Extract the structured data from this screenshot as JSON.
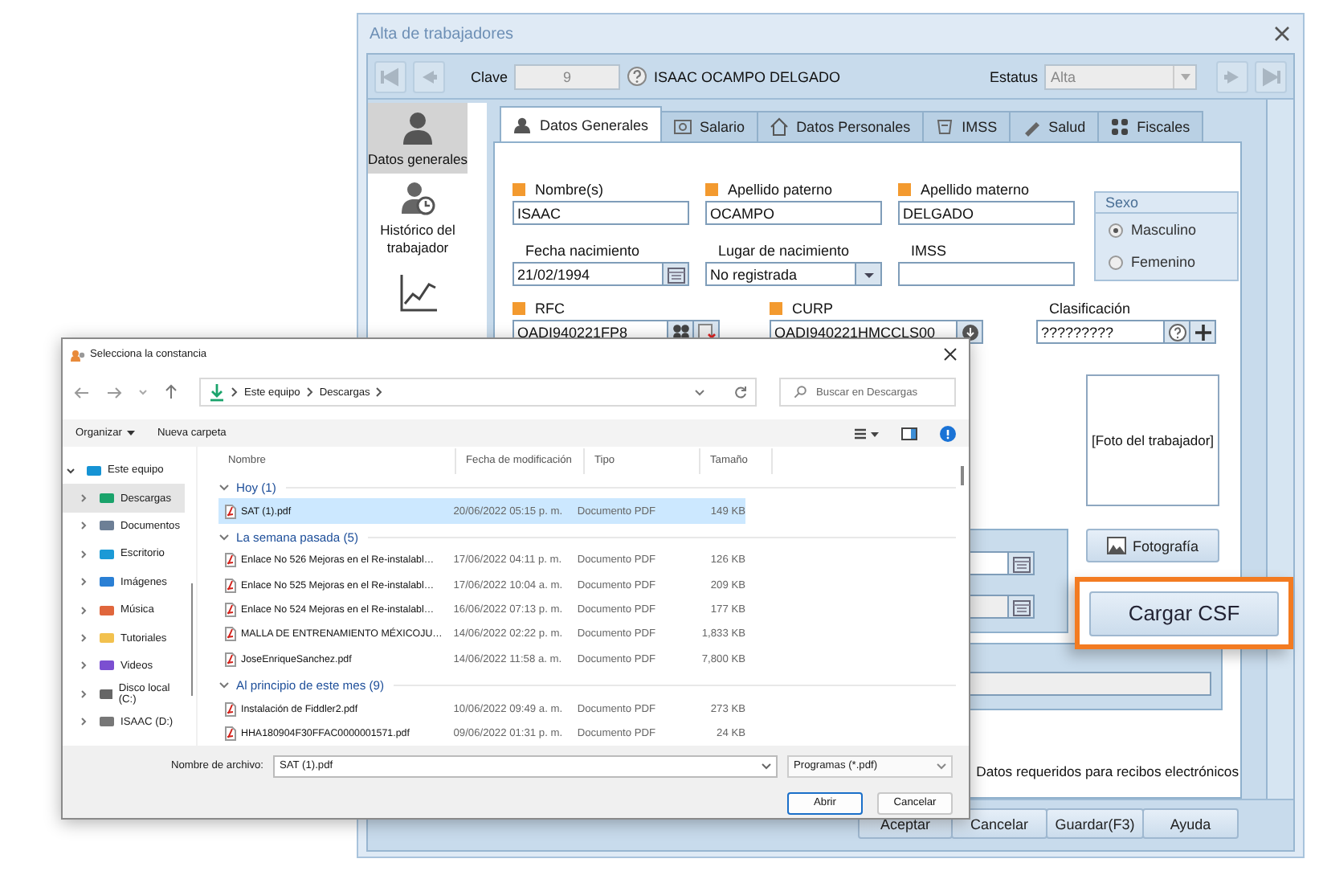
{
  "window": {
    "title": "Alta de trabajadores"
  },
  "record_bar": {
    "clave_label": "Clave",
    "clave": {
      "value": "9",
      "disabled": true
    },
    "employee_name": "ISAAC OCAMPO DELGADO",
    "estatus_label": "Estatus",
    "estatus": {
      "value": "Alta",
      "disabled": true
    }
  },
  "side_nav": [
    {
      "label": "Datos generales",
      "selected": true
    },
    {
      "label": "Histórico del trabajador",
      "selected": false
    }
  ],
  "tabs": [
    {
      "label": "Datos Generales",
      "selected": true
    },
    {
      "label": "Salario",
      "selected": false
    },
    {
      "label": "Datos Personales",
      "selected": false
    },
    {
      "label": "IMSS",
      "selected": false
    },
    {
      "label": "Salud",
      "selected": false
    },
    {
      "label": "Fiscales",
      "selected": false
    }
  ],
  "fields": [
    {
      "label": "Nombre(s)",
      "kind": "text",
      "required": true,
      "value": "ISAAC"
    },
    {
      "label": "Apellido paterno",
      "kind": "text",
      "required": true,
      "value": "OCAMPO"
    },
    {
      "label": "Apellido materno",
      "kind": "text",
      "required": true,
      "value": "DELGADO"
    },
    {
      "label": "Fecha nacimiento",
      "kind": "date",
      "required": false,
      "value": "21/02/1994"
    },
    {
      "label": "Lugar de nacimiento",
      "kind": "dropdown",
      "required": false,
      "value": "No registrada"
    },
    {
      "label": "IMSS",
      "kind": "text",
      "required": false
    },
    {
      "label": "RFC",
      "kind": "rfc",
      "required": true,
      "value": "OADI940221FP8"
    },
    {
      "label": "CURP",
      "kind": "curp",
      "required": true,
      "value": "OADI940221HMCCLS00"
    },
    {
      "label": "Clasificación",
      "kind": "clasificacion",
      "required": false,
      "value": "?????????"
    }
  ],
  "sexo": {
    "title": "Sexo",
    "options": [
      {
        "label": "Masculino",
        "selected": true
      },
      {
        "label": "Femenino",
        "selected": false
      }
    ]
  },
  "photo": {
    "placeholder_text": "[Foto del trabajador]",
    "button": "Fotografía"
  },
  "cargar_csf": {
    "label": "Cargar CSF",
    "highlighted": true
  },
  "note": "Datos requeridos para recibos electrónicos",
  "buttons": [
    "Aceptar",
    "Cancelar",
    "Guardar(F3)",
    "Ayuda"
  ],
  "file_dialog": {
    "title": "Selecciona la constancia",
    "path": [
      "Este equipo",
      "Descargas"
    ],
    "search": {
      "placeholder": "Buscar en Descargas"
    },
    "toolbar": [
      "Organizar",
      "Nueva carpeta"
    ],
    "nav": [
      {
        "label": "Este equipo",
        "expanded": true,
        "selected": false,
        "children": [
          {
            "label": "Descargas",
            "expanded": false,
            "selected": true
          },
          {
            "label": "Documentos",
            "expanded": false,
            "selected": false
          },
          {
            "label": "Escritorio",
            "expanded": false,
            "selected": false
          },
          {
            "label": "Imágenes",
            "expanded": false,
            "selected": false
          },
          {
            "label": "Música",
            "expanded": false,
            "selected": false
          },
          {
            "label": "Tutoriales",
            "expanded": false,
            "selected": false
          },
          {
            "label": "Videos",
            "expanded": false,
            "selected": false
          },
          {
            "label": "Disco local (C:)",
            "expanded": false,
            "selected": false
          },
          {
            "label": "ISAAC (D:)",
            "expanded": false,
            "selected": false
          }
        ]
      }
    ],
    "columns": [
      "Nombre",
      "Fecha de modificación",
      "Tipo",
      "Tamaño"
    ],
    "groups": [
      {
        "title": "Hoy (1)",
        "expanded": true,
        "rows": [
          {
            "name": "SAT (1).pdf",
            "date": "20/06/2022 05:15 p. m.",
            "type": "Documento PDF",
            "size": "149 KB",
            "selected": true
          }
        ]
      },
      {
        "title": "La semana pasada (5)",
        "expanded": true,
        "rows": [
          {
            "name": "Enlace No 526 Mejoras en el Re-instalabl…",
            "date": "17/06/2022 04:11 p. m.",
            "type": "Documento PDF",
            "size": "126 KB",
            "selected": false
          },
          {
            "name": "Enlace No 525 Mejoras en el Re-instalabl…",
            "date": "17/06/2022 10:04 a. m.",
            "type": "Documento PDF",
            "size": "209 KB",
            "selected": false
          },
          {
            "name": "Enlace No 524 Mejoras en el Re-instalabl…",
            "date": "16/06/2022 07:13 p. m.",
            "type": "Documento PDF",
            "size": "177 KB",
            "selected": false
          },
          {
            "name": "MALLA DE ENTRENAMIENTO MÉXICOJU…",
            "date": "14/06/2022 02:22 p. m.",
            "type": "Documento PDF",
            "size": "1,833 KB",
            "selected": false
          },
          {
            "name": "JoseEnriqueSanchez.pdf",
            "date": "14/06/2022 11:58 a. m.",
            "type": "Documento PDF",
            "size": "7,800 KB",
            "selected": false
          }
        ]
      },
      {
        "title": "Al principio de este mes (9)",
        "expanded": true,
        "rows": [
          {
            "name": "Instalación de Fiddler2.pdf",
            "date": "10/06/2022 09:49 a. m.",
            "type": "Documento PDF",
            "size": "273 KB",
            "selected": false
          },
          {
            "name": "HHA180904F30FFAC0000001571.pdf",
            "date": "09/06/2022 01:31 p. m.",
            "type": "Documento PDF",
            "size": "24 KB",
            "selected": false
          }
        ]
      }
    ],
    "filename": {
      "label": "Nombre de archivo:",
      "value": "SAT (1).pdf"
    },
    "filter": "Programas (*.pdf)",
    "buttons": [
      "Abrir",
      "Cancelar"
    ]
  }
}
